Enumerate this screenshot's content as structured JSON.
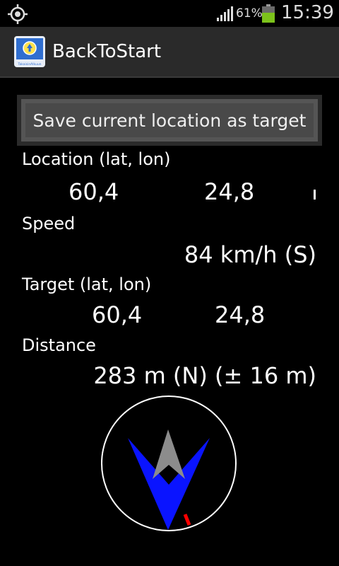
{
  "status_bar": {
    "battery_percent": "61%",
    "time": "15:39",
    "battery_level": 0.61
  },
  "app": {
    "title": "BackToStart",
    "icon_text": "TakaisinAlkuun"
  },
  "save_button": {
    "label": "Save current location as target"
  },
  "location": {
    "label": "Location (lat, lon)",
    "lat": "60,4",
    "lon": "24,8"
  },
  "speed": {
    "label": "Speed",
    "value": "84 km/h (S)"
  },
  "target": {
    "label": "Target (lat, lon)",
    "lat": "60,4",
    "lon": "24,8"
  },
  "distance": {
    "label": "Distance",
    "value": "283 m (N) (± 16 m)"
  },
  "compass": {
    "arrow_color": "#0a14ff",
    "needle_color": "#8c8c8c",
    "marker_color": "#ff0000",
    "ring_color": "#ffffff"
  }
}
